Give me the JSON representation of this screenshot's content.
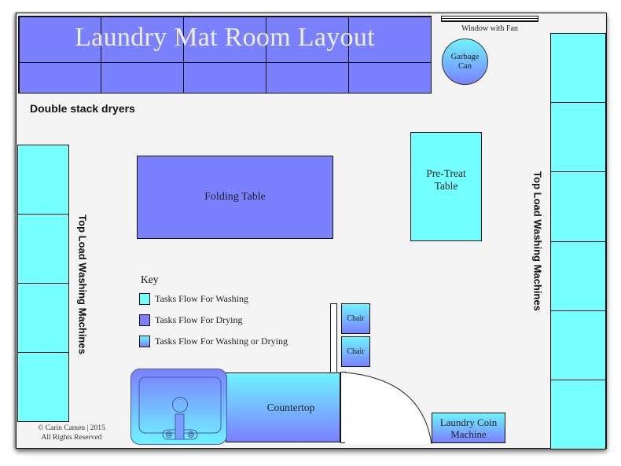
{
  "title": "Laundry Mat Room Layout",
  "colors": {
    "drying": "#7b80ff",
    "washing": "#75ffff",
    "both_gradient_top": "#6ff4ff",
    "both_gradient_bottom": "#7b80ff",
    "floor": "#f4f4f4"
  },
  "dryers": {
    "label": "Double stack dryers",
    "columns": 5,
    "rows": 2
  },
  "window": {
    "label": "Window with Fan"
  },
  "garbage_can": {
    "label_line1": "Garbage",
    "label_line2": "Can"
  },
  "washers_left": {
    "label": "Top Load Washing Machines",
    "count": 4
  },
  "washers_right": {
    "label": "Top Load Washing Machines",
    "count": 6
  },
  "folding_table": {
    "label": "Folding Table"
  },
  "pretreat_table": {
    "label_line1": "Pre-Treat",
    "label_line2": "Table"
  },
  "key": {
    "title": "Key",
    "items": [
      {
        "label": "Tasks Flow For Washing",
        "type": "washing"
      },
      {
        "label": "Tasks Flow For Drying",
        "type": "drying"
      },
      {
        "label": "Tasks Flow For Washing or Drying",
        "type": "both"
      }
    ]
  },
  "chairs": [
    {
      "label": "Chair"
    },
    {
      "label": "Chair"
    }
  ],
  "countertop": {
    "label": "Countertop"
  },
  "coin_machine": {
    "label_line1": "Laundry Coin",
    "label_line2": "Machine"
  },
  "copyright": {
    "line1": "© Carin Camen | 2015",
    "line2": "All Rights Reserved"
  }
}
